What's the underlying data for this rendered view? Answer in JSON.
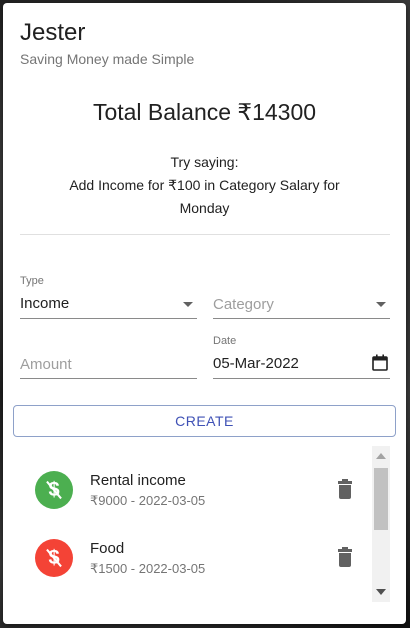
{
  "app": {
    "title": "Jester",
    "subtitle": "Saving Money made Simple"
  },
  "balance": {
    "text": "Total Balance ₹14300"
  },
  "hint": {
    "line1": "Try saying:",
    "line2": "Add Income for ₹100 in Category Salary for Monday"
  },
  "form": {
    "type": {
      "label": "Type",
      "value": "Income"
    },
    "category": {
      "placeholder": "Category"
    },
    "amount": {
      "placeholder": "Amount"
    },
    "date": {
      "label": "Date",
      "value": "05-Mar-2022"
    },
    "create_label": "CREATE"
  },
  "transactions": [
    {
      "name": "Rental income",
      "meta": "₹9000 - 2022-03-05",
      "color": "#4caf50",
      "icon": "income-icon"
    },
    {
      "name": "Food",
      "meta": "₹1500 - 2022-03-05",
      "color": "#f44336",
      "icon": "expense-icon"
    }
  ],
  "colors": {
    "income": "#4caf50",
    "expense": "#f44336",
    "accent": "#3f51b5"
  }
}
